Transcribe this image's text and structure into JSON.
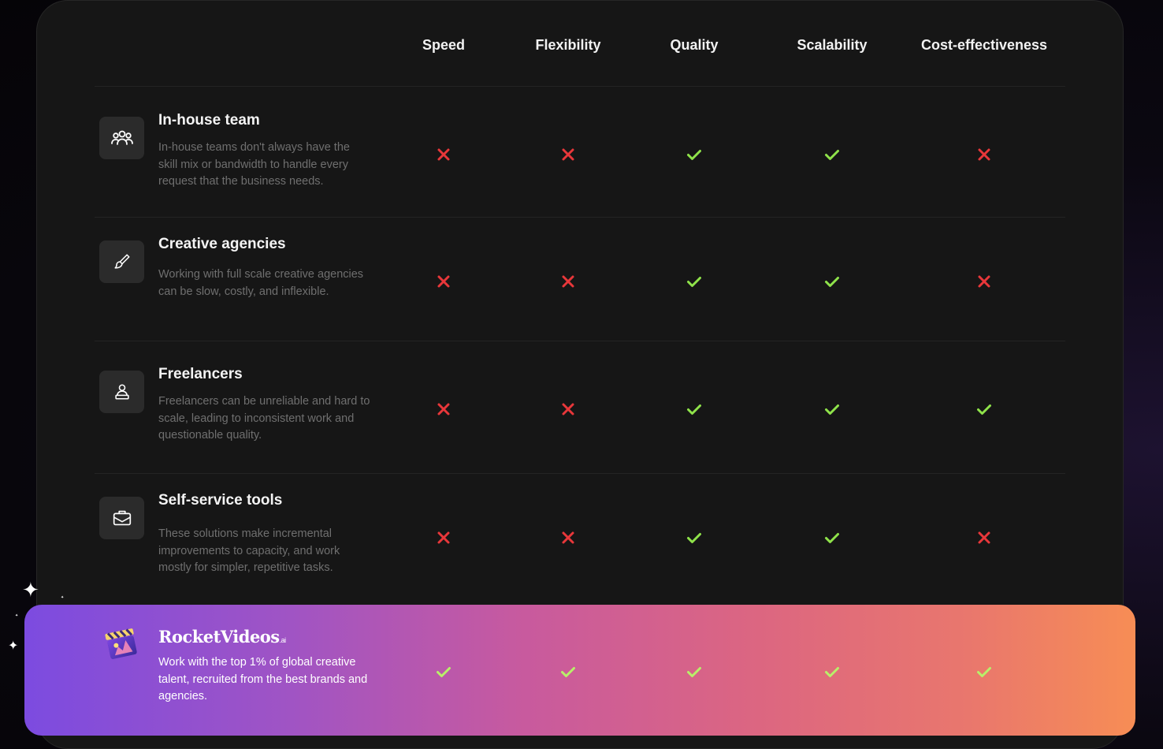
{
  "columns": [
    "Speed",
    "Flexibility",
    "Quality",
    "Scalability",
    "Cost-effectiveness"
  ],
  "rows": [
    {
      "icon": "team-icon",
      "title": "In-house team",
      "description": "In-house teams don't always have the skill mix or bandwidth to handle every request that the business needs.",
      "marks": [
        "cross",
        "cross",
        "check",
        "check",
        "cross"
      ]
    },
    {
      "icon": "brush-icon",
      "title": "Creative agencies",
      "description": "Working with full scale creative agencies can be slow, costly, and inflexible.",
      "marks": [
        "cross",
        "cross",
        "check",
        "check",
        "cross"
      ]
    },
    {
      "icon": "freelancer-icon",
      "title": "Freelancers",
      "description": "Freelancers can be unreliable and hard to scale, leading to inconsistent work and questionable quality.",
      "marks": [
        "cross",
        "cross",
        "check",
        "check",
        "check"
      ]
    },
    {
      "icon": "toolbox-icon",
      "title": "Self-service tools",
      "description": "These solutions make incremental improvements to capacity, and work mostly for simpler, repetitive tasks.",
      "marks": [
        "cross",
        "cross",
        "check",
        "check",
        "cross"
      ]
    }
  ],
  "highlight": {
    "brand": "RocketVideos",
    "brand_suffix": ".ai",
    "description": "Work with the top 1% of global creative talent, recruited from the best brands and agencies.",
    "marks": [
      "check",
      "check",
      "check",
      "check",
      "check"
    ]
  },
  "colors": {
    "check": "#8fe34a",
    "cross": "#e8373a",
    "banner_check": "#b8f06a"
  }
}
